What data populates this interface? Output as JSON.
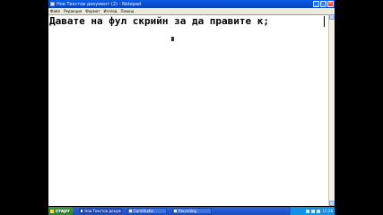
{
  "window": {
    "title": "Нов Текстов документ (2) - Notepad",
    "buttons": {
      "minimize": "_",
      "maximize": "□",
      "close": "×"
    }
  },
  "menu": [
    "Файл",
    "Редакция",
    "Формат",
    "Изглед",
    "Помощ"
  ],
  "editor": {
    "text": "Давате на фул скрийн за да правите к;"
  },
  "taskbar": {
    "start_label": "старт",
    "tasks": [
      {
        "label": "Нов Текстов документ..."
      },
      {
        "label": "CamStudio"
      },
      {
        "label": "Recording"
      }
    ],
    "clock": "11:28"
  }
}
